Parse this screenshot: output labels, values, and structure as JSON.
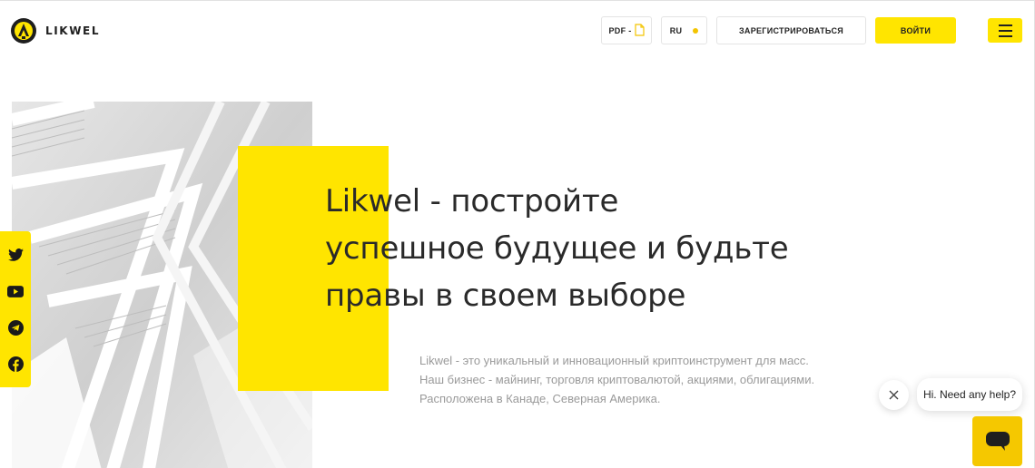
{
  "brand": {
    "name": "LIKWEL"
  },
  "header": {
    "pdf_label": "PDF -",
    "lang_label": "RU",
    "register_label": "ЗАРЕГИСТРИРОВАТЬСЯ",
    "login_label": "ВОЙТИ"
  },
  "hero": {
    "title_line1": "Likwel - постройте",
    "title_line2": "успешное будущее и будьте",
    "title_line3": "правы в своем выборе",
    "description": "Likwel - это уникальный и инновационный криптоинструмент для масс. Наш бизнес - майнинг, торговля криптовалютой, акциями, облигациями. Расположена в Канаде, Северная Америка."
  },
  "social": {
    "icons": [
      "twitter-icon",
      "youtube-icon",
      "telegram-icon",
      "facebook-icon"
    ]
  },
  "chat": {
    "greeting": "Hi. Need any help?"
  },
  "colors": {
    "accent": "#ffe500",
    "text": "#2a2a2a",
    "muted": "#9a9a9a"
  }
}
